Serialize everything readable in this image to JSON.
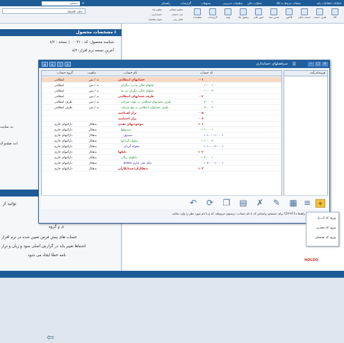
{
  "menubar": {
    "items": [
      "امکانات اطلاعات پایه",
      "عملیات مرتبط به کالا",
      "عملیات مالی",
      "تنظیمات مدیریتی",
      "تسهیلات",
      "گزارشات",
      "راهنمای"
    ],
    "search_placeholder": "جستجو..."
  },
  "toolbar": {
    "left_field": "حالت کاشمک",
    "buttons": [
      "کالا",
      "طرف حساب",
      "حساب بانکی",
      "فاکتور",
      "صدور سند",
      "امور مالی",
      "وصول چک",
      "تولید",
      "گزارشات",
      "تنظیمات"
    ],
    "small_items": [
      "تنظیم اتصالی",
      "ثبت حساب",
      "تغییر رمز",
      "تنظیم ماه",
      "حسابداری",
      "منوی پشتیبان"
    ]
  },
  "left_panel": {
    "header": "مشخصات محصول",
    "product_id_line": "شناسه محصول:  کد : ۰۰۰۴۱ | نسخه : ۸/۲",
    "last_version_line": "آخرین نسخه نرم افزار: ۸/۲",
    "side_text_1": "ت سایت",
    "side_text_2": "ات مشترک",
    "news_header": "",
    "body_lines": [
      "توانید از",
      "ی و گروه",
      "حساب های پیش فرض تعیین شده در نرم افزار",
      "اشتباها تغییر یابد در گزارش اصلی سود و زیان و تراز",
      "نامه خطا ایجاد می شود"
    ]
  },
  "dialog": {
    "title": "سرفصلهای حسابداری",
    "keys": [
      "N",
      "K",
      "T",
      "R"
    ],
    "columns": {
      "code": "کد حساب",
      "name": "نام حساب",
      "nature": "ماهیت",
      "group": "گروه حساب",
      "notes": "هزینه/درآمد"
    },
    "rows": [
      {
        "code": "۰۰۱",
        "name": "حسابهای انتظامی",
        "nature": "بد / بس",
        "group": "انتظامی",
        "level": 1
      },
      {
        "code": "۰۰۱-۰۰۰۱",
        "name": "چکهای خالی ما نزد دیگران",
        "nature": "بد / بس",
        "group": "انتظامی",
        "level": 2
      },
      {
        "code": "۰۰۱-۰۰۰۲",
        "name": "چکهای خالی دیگران نزد ما",
        "nature": "بد / بس",
        "group": "انتظامی",
        "level": 2
      },
      {
        "code": "۰۰۲",
        "name": "طرف حسابهای انتظامی",
        "nature": "بد / بس",
        "group": "انتظامی",
        "level": 1
      },
      {
        "code": "۰۰۲-۰۰۰۱",
        "name": "طرف حسابهای انتظامی به عهده شرکت",
        "nature": "بد / بس",
        "group": "طرف انتظامی",
        "level": 2
      },
      {
        "code": "۰۰۲-۰۰۰۲",
        "name": "طرف حسابهای انتظامی به نفع شرکت",
        "nature": "بد / بس",
        "group": "طرف انتظامی",
        "level": 2
      },
      {
        "code": "۰۰۵",
        "name": "تراز افتتاحیه",
        "nature": "",
        "group": "",
        "level": 1
      },
      {
        "code": "۰۰۶",
        "name": "تراز اختتامیه",
        "nature": "",
        "group": "",
        "level": 1
      },
      {
        "code": "۱۰۱",
        "name": "موجودیهای نقدی",
        "nature": "بدهکار",
        "group": "دارائیهای جاری",
        "level": 1
      },
      {
        "code": "۱۰۱-۰۰۰۱",
        "name": "صندوقها",
        "nature": "بدهکار",
        "group": "دارائیهای جاری",
        "level": 2
      },
      {
        "code": "۱۰۱-۰۰۰۱-۰۰۰۱",
        "name": "صندوق",
        "nature": "بدهکار",
        "group": "دارائیهای جاری",
        "level": 3
      },
      {
        "code": "۱۰۱-۰۰۰۲",
        "name": "تنخواه گردانها",
        "nature": "بدهکار",
        "group": "دارائیهای جاری",
        "level": 2
      },
      {
        "code": "۱۰۱-۰۰۰۲-۰۰۰۱",
        "name": "تنخواه گردان",
        "nature": "بدهکار",
        "group": "دارائیهای جاری",
        "level": 3
      },
      {
        "code": "۱۰۲",
        "name": "بانکها",
        "nature": "بدهکار",
        "group": "دارائیهای جاری",
        "level": 1
      },
      {
        "code": "۱۰۲-۰۰۰۱",
        "name": "بانکهای ریالی",
        "nature": "بدهکار",
        "group": "دارائیهای جاری",
        "level": 2
      },
      {
        "code": "۱۰۲-۰۰۰۱-۰۰۰۱",
        "name": "بانک ملی جاری ۵۲۵۲۵",
        "nature": "بدهکار",
        "group": "دارائیهای جاری",
        "level": 3
      },
      {
        "code": "۱۰۳",
        "name": "بدهکاران/بستانکاران",
        "nature": "بدهکار",
        "group": "دارائیهای جاری",
        "level": 1
      }
    ],
    "level_menu": [
      "ورود کد کــــل",
      "ورود کد معیــن",
      "ورود کد تفصیلی"
    ],
    "help_text": "راهنما=Ctrl+F1 برای جستجو براساس کد یا نام حساب، درستون مربوطه، کد و یا نام مورد نظر را وارد نمائید."
  },
  "footer": {
    "logo": "HOLOO"
  }
}
